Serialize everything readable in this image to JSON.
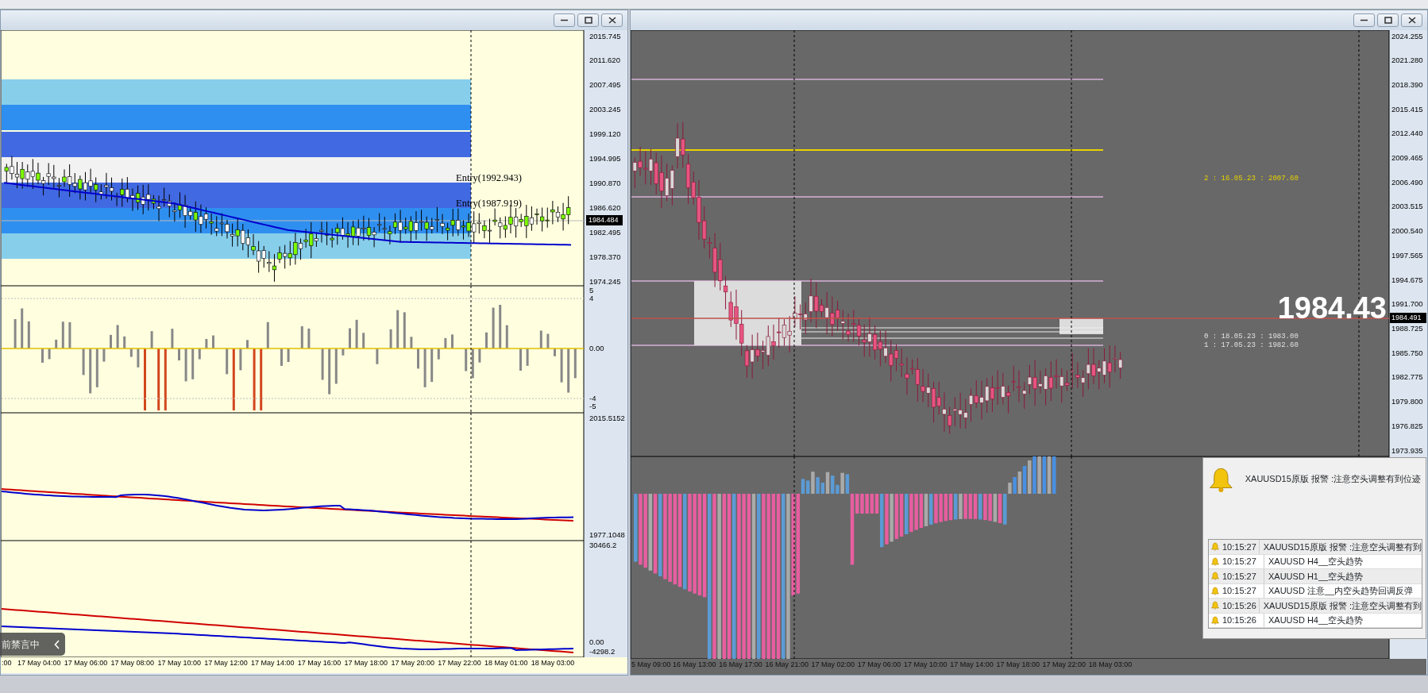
{
  "left_window": {
    "main_chart": {
      "price_ticks": [
        "2015.745",
        "2011.620",
        "2007.495",
        "2003.245",
        "1999.120",
        "1994.995",
        "1990.870",
        "1986.620",
        "1982.495",
        "1978.370",
        "1974.245"
      ],
      "current_price": "1984.484",
      "entry_labels": [
        "Entry(1992.943)",
        "Entry(1987.919)"
      ]
    },
    "oscillator_panel": {
      "ticks": [
        "5",
        "4",
        "0.00",
        "-4",
        "-5"
      ]
    },
    "line_panel": {
      "ticks": [
        "2015.5152",
        "1977.1048"
      ]
    },
    "volume_panel": {
      "ticks": [
        "30466.2",
        "0.00",
        "-4298.2"
      ]
    },
    "time_axis": [
      ":00",
      "17 May 04:00",
      "17 May 06:00",
      "17 May 08:00",
      "17 May 10:00",
      "17 May 12:00",
      "17 May 14:00",
      "17 May 16:00",
      "17 May 18:00",
      "17 May 20:00",
      "17 May 22:00",
      "18 May 01:00",
      "18 May 03:00"
    ]
  },
  "right_window": {
    "main_chart": {
      "price_ticks": [
        "2024.255",
        "2021.280",
        "2018.390",
        "2015.415",
        "2012.440",
        "2009.465",
        "2006.490",
        "2003.515",
        "2000.540",
        "1997.565",
        "1994.675",
        "1991.700",
        "1988.725",
        "1985.750",
        "1982.775",
        "1979.800",
        "1976.825",
        "1973.935"
      ],
      "current_price": "1984.491",
      "big_price": "1984.43",
      "level_labels": [
        "2 : 16.05.23 : 2007.60",
        "0 : 18.05.23 : 1983.00",
        "1 : 17.05.23 : 1982.60"
      ]
    },
    "time_axis": [
      "5 May 09:00",
      "16 May 13:00",
      "16 May 17:00",
      "16 May 21:00",
      "17 May 02:00",
      "17 May 06:00",
      "17 May 10:00",
      "17 May 14:00",
      "17 May 18:00",
      "17 May 22:00",
      "18 May 03:00"
    ]
  },
  "alert": {
    "message": "XAUUSD15原版 报警 :注意空头调整有到位迹",
    "log": [
      {
        "time": "10:15:27",
        "text": "XAUUSD15原版 报警 :注意空头调整有到"
      },
      {
        "time": "10:15:27",
        "text": "XAUUSD H4__空头趋势"
      },
      {
        "time": "10:15:27",
        "text": "XAUUSD H1__空头趋势"
      },
      {
        "time": "10:15:27",
        "text": "XAUUSD 注意__内空头趋势回调反弹"
      },
      {
        "time": "10:15:26",
        "text": "XAUUSD15原版 报警 :注意空头调整有到"
      },
      {
        "time": "10:15:26",
        "text": "XAUUSD H4__空头趋势"
      }
    ]
  },
  "chat_overlay": {
    "text": "前禁言中"
  }
}
